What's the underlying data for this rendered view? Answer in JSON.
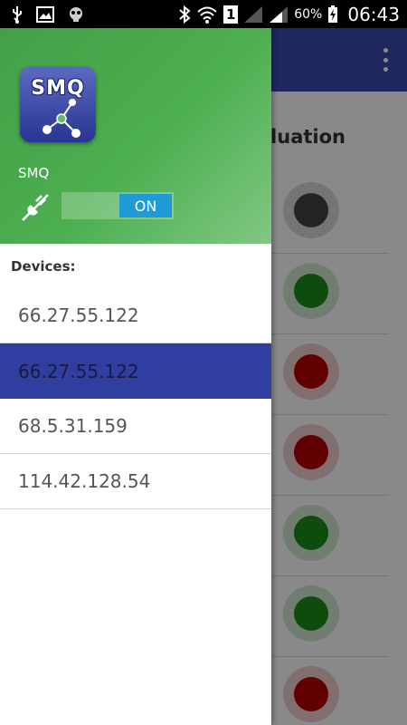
{
  "status_bar": {
    "icons_left": [
      "usb-icon",
      "image-icon",
      "skull-notification-icon"
    ],
    "icons_right": [
      "bluetooth-icon",
      "wifi-icon",
      "sim-1-icon",
      "signal-weak-icon",
      "signal-icon",
      "battery-charging-icon"
    ],
    "sim_label": "1",
    "battery": "60%",
    "time": "06:43"
  },
  "app": {
    "toolbar_color": "#3949ab",
    "title": "aluation",
    "overflow_icon": "more-vert-icon",
    "rows": [
      {
        "status": "gray",
        "color": "#424242"
      },
      {
        "status": "green",
        "color": "#1b8a1b"
      },
      {
        "status": "red",
        "color": "#b00000"
      },
      {
        "status": "red",
        "color": "#b00000"
      },
      {
        "status": "green",
        "color": "#1b8a1b"
      },
      {
        "status": "green",
        "color": "#1b8a1b"
      },
      {
        "status": "red",
        "color": "#b00000"
      }
    ]
  },
  "drawer": {
    "header_color": "#4caf50",
    "logo_text": "SMQ",
    "app_name": "SMQ",
    "connection_icon": "unplugged-icon",
    "toggle_label": "ON",
    "toggle_color": "#1e9bd6",
    "devices_label": "Devices:",
    "devices": [
      {
        "label": "66.27.55.122",
        "selected": false
      },
      {
        "label": "66.27.55.122",
        "selected": true
      },
      {
        "label": "68.5.31.159",
        "selected": false
      },
      {
        "label": "114.42.128.54",
        "selected": false
      }
    ],
    "selected_color": "#303f9f"
  }
}
